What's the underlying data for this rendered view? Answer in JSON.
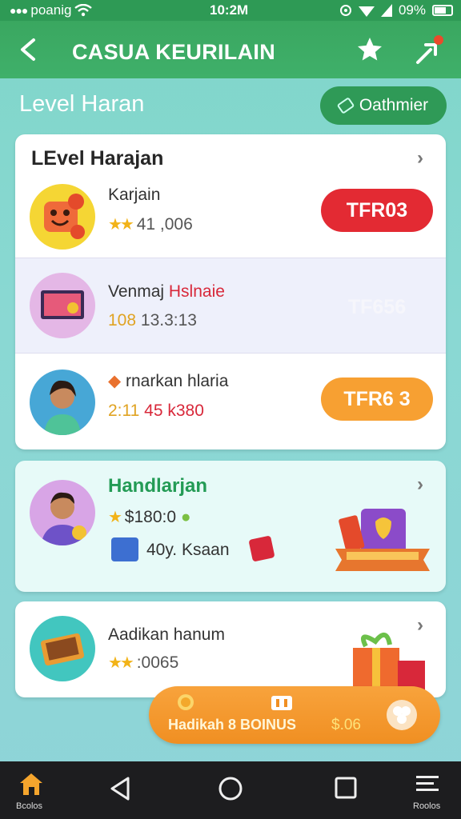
{
  "status_bar": {
    "carrier": "poanig",
    "time": "10:2M",
    "battery": "09%"
  },
  "header": {
    "title": "CASUA KEURILAIN",
    "back_icon": "chevron-left-icon",
    "star_icon": "star-icon",
    "share_icon": "share-icon"
  },
  "subheader": {
    "title": "Level Haran",
    "button_label": "Oathmier"
  },
  "group1": {
    "title": "LEvel Harajan",
    "rows": [
      {
        "name": "Karjain",
        "stats": "41 ,006",
        "badge": "TFR03",
        "badge_color": "#e32a33"
      },
      {
        "name_a": "Venmaj",
        "name_b": "Hslnaie",
        "stat_a": "108",
        "stat_b": "13.3:13",
        "badge": "TF656"
      },
      {
        "name": "rnarkan hlaria",
        "stat_a": "2:11",
        "stat_b": "45 k380",
        "badge": "TFR6 3",
        "badge_color": "#f7a032"
      }
    ]
  },
  "card2": {
    "title": "Handlarjan",
    "stats": "$180:0",
    "sub": "40y. Ksaan"
  },
  "card3": {
    "title": "Aadikan hanum",
    "stats": ":0065"
  },
  "bonus": {
    "label": "Hadikah 8 BOINUS",
    "value": "$.06"
  },
  "nav": {
    "home_label": "Bcolos",
    "menu_label": "Roolos"
  },
  "colors": {
    "primary_green": "#3aa760",
    "accent_orange": "#f7a032",
    "accent_red": "#e32a33"
  }
}
